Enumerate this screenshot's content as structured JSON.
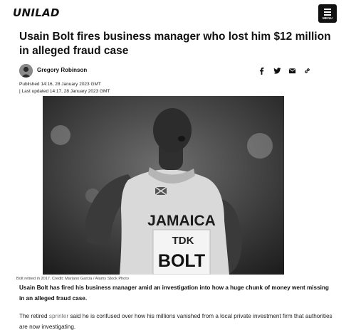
{
  "header": {
    "logo": "UNILAD",
    "menu_label": "MENU"
  },
  "article": {
    "headline": "Usain Bolt fires business manager who lost him $12 million in alleged fraud case",
    "author": "Gregory Robinson",
    "published": "Published 14:16, 28 January 2023 GMT",
    "updated": "| Last updated 14:17, 28 January 2023 GMT",
    "image_caption": "Bolt retired in 2017. Credit: Mariano Garcia / Alamy Stock Photo",
    "bib_country": "JAMAICA",
    "bib_sponsor": "TDK",
    "bib_name": "BOLT",
    "lede": "Usain Bolt has fired his business manager amid an investigation into how a huge chunk of money went missing in an alleged fraud case.",
    "para_prefix": "The retired ",
    "para_link": "sprinter",
    "para_suffix": " said he is confused over how his millions vanished from a local private investment firm that authorities are now investigating."
  },
  "share": [
    "facebook-icon",
    "twitter-icon",
    "email-icon",
    "link-icon"
  ],
  "colors": {
    "brand": "#111111",
    "link": "#777777"
  }
}
